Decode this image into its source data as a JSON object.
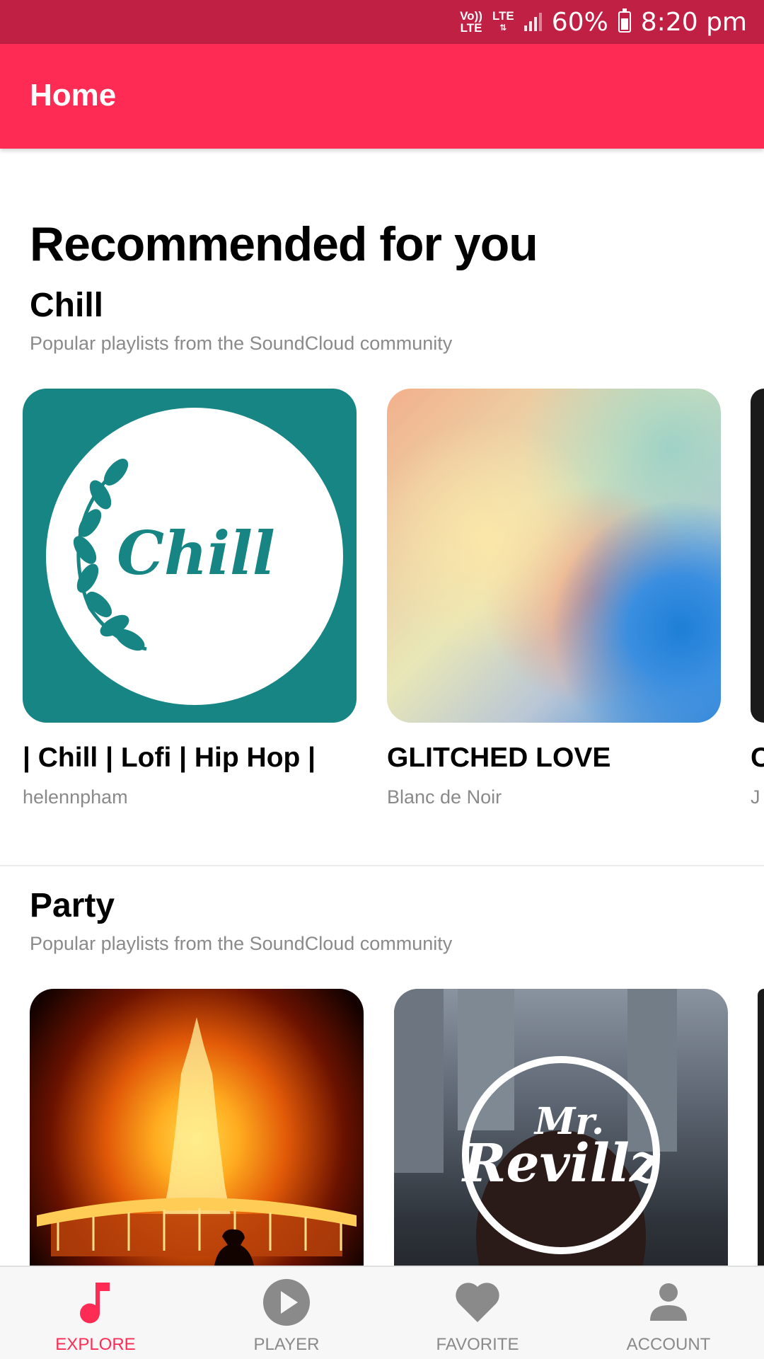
{
  "status_bar": {
    "volte_top": "Vo))",
    "volte_bottom": "LTE",
    "lte": "LTE",
    "battery": "60%",
    "time": "8:20 pm",
    "battery_level": 0.6
  },
  "app_bar": {
    "title": "Home"
  },
  "page_heading": "Recommended for you",
  "sections": [
    {
      "title": "Chill",
      "subtitle": "Popular playlists from the SoundCloud community",
      "cards": [
        {
          "title": "| Chill | Lofi | Hip Hop |",
          "artist": "helennpham",
          "art_text": "Chill"
        },
        {
          "title": "GLITCHED LOVE",
          "artist": "Blanc de Noir"
        },
        {
          "title": "C",
          "artist": "J"
        }
      ]
    },
    {
      "title": "Party",
      "subtitle": "Popular playlists from the SoundCloud community",
      "cards": [
        {
          "art_text_top": "Mr.",
          "art_text_bottom": "Revillz"
        }
      ]
    }
  ],
  "bottom_nav": [
    {
      "label": "EXPLORE",
      "icon": "music-note-icon",
      "active": true
    },
    {
      "label": "PLAYER",
      "icon": "play-circle-icon",
      "active": false
    },
    {
      "label": "FAVORITE",
      "icon": "heart-icon",
      "active": false
    },
    {
      "label": "ACCOUNT",
      "icon": "person-icon",
      "active": false
    }
  ],
  "colors": {
    "status_bar": "#bf2043",
    "accent": "#fe2c55",
    "secondary_text": "#8a8a8a",
    "inactive_icon": "#8a8a8a"
  }
}
